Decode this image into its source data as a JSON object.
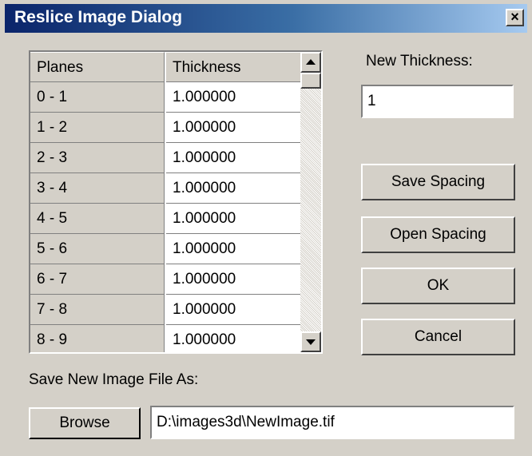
{
  "window": {
    "title": "Reslice Image Dialog",
    "close_glyph": "×"
  },
  "table": {
    "columns": [
      "Planes",
      "Thickness"
    ],
    "rows": [
      {
        "planes": "0 - 1",
        "thickness": "1.000000"
      },
      {
        "planes": "1 - 2",
        "thickness": "1.000000"
      },
      {
        "planes": "2 - 3",
        "thickness": "1.000000"
      },
      {
        "planes": "3 - 4",
        "thickness": "1.000000"
      },
      {
        "planes": "4 - 5",
        "thickness": "1.000000"
      },
      {
        "planes": "5 - 6",
        "thickness": "1.000000"
      },
      {
        "planes": "6 - 7",
        "thickness": "1.000000"
      },
      {
        "planes": "7 - 8",
        "thickness": "1.000000"
      },
      {
        "planes": "8 - 9",
        "thickness": "1.000000"
      }
    ],
    "scroll": {
      "up_icon": "arrow-up-icon",
      "down_icon": "arrow-down-icon"
    }
  },
  "new_thickness": {
    "label": "New Thickness:",
    "value": "1"
  },
  "buttons": {
    "save_spacing": "Save Spacing",
    "open_spacing": "Open Spacing",
    "ok": "OK",
    "cancel": "Cancel",
    "browse": "Browse"
  },
  "save_as": {
    "label": "Save New Image File As:",
    "value": "D:\\images3d\\NewImage.tif"
  },
  "colors": {
    "titlebar_start": "#0a246a",
    "titlebar_end": "#a6caf0",
    "face": "#d4d0c8"
  }
}
